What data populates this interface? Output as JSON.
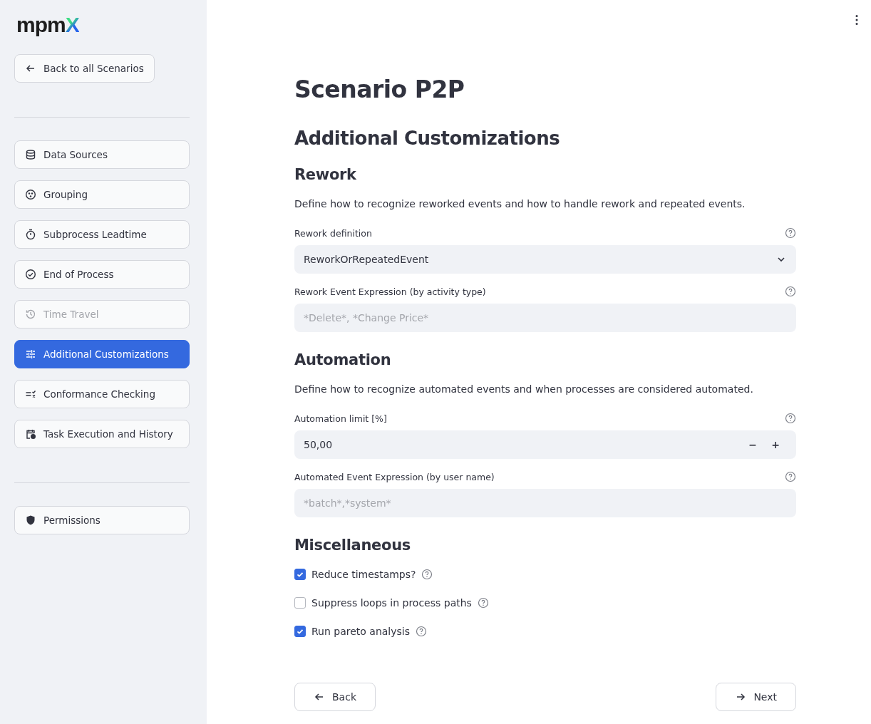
{
  "logo": {
    "text": "mpm",
    "mark": "X"
  },
  "back_link": {
    "label": "Back to all Scenarios"
  },
  "nav_items": [
    {
      "label": "Data Sources",
      "kind": "database",
      "selected": false,
      "disabled": false
    },
    {
      "label": "Grouping",
      "kind": "grouping",
      "selected": false,
      "disabled": false
    },
    {
      "label": "Subprocess Leadtime",
      "kind": "stopwatch",
      "selected": false,
      "disabled": false
    },
    {
      "label": "End of Process",
      "kind": "check",
      "selected": false,
      "disabled": false
    },
    {
      "label": "Time Travel",
      "kind": "history",
      "selected": false,
      "disabled": true
    },
    {
      "label": "Additional Customizations",
      "kind": "sliders",
      "selected": true,
      "disabled": false
    },
    {
      "label": "Conformance Checking",
      "kind": "conformance",
      "selected": false,
      "disabled": false
    },
    {
      "label": "Task Execution and History",
      "kind": "calendar",
      "selected": false,
      "disabled": false
    }
  ],
  "bottom_items": [
    {
      "label": "Permissions",
      "kind": "shield",
      "selected": false,
      "disabled": false
    }
  ],
  "title": "Scenario P2P",
  "subtitle": "Additional Customizations",
  "sections": [
    {
      "heading": "Rework",
      "description": "Define how to recognize reworked events and how to handle rework and repeated events.",
      "fields": [
        {
          "kind": "select",
          "label": "Rework definition",
          "value": "ReworkOrRepeatedEvent"
        },
        {
          "kind": "text",
          "label": "Rework Event Expression (by activity type)",
          "placeholder": "*Delete*, *Change Price*"
        }
      ]
    },
    {
      "heading": "Automation",
      "description": "Define how to recognize automated events and when processes are considered automated.",
      "fields": [
        {
          "kind": "number",
          "label": "Automation limit [%]",
          "value": "50,00",
          "minus": "−",
          "plus": "+"
        },
        {
          "kind": "text",
          "label": "Automated Event Expression (by user name)",
          "placeholder": "*batch*,*system*"
        }
      ]
    }
  ],
  "misc": {
    "heading": "Miscellaneous",
    "checkboxes": [
      {
        "label": "Reduce timestamps?",
        "checked": true
      },
      {
        "label": "Suppress loops in process paths",
        "checked": false
      },
      {
        "label": "Run pareto analysis",
        "checked": true
      }
    ]
  },
  "buttons": {
    "back": "Back",
    "next": "Next"
  }
}
